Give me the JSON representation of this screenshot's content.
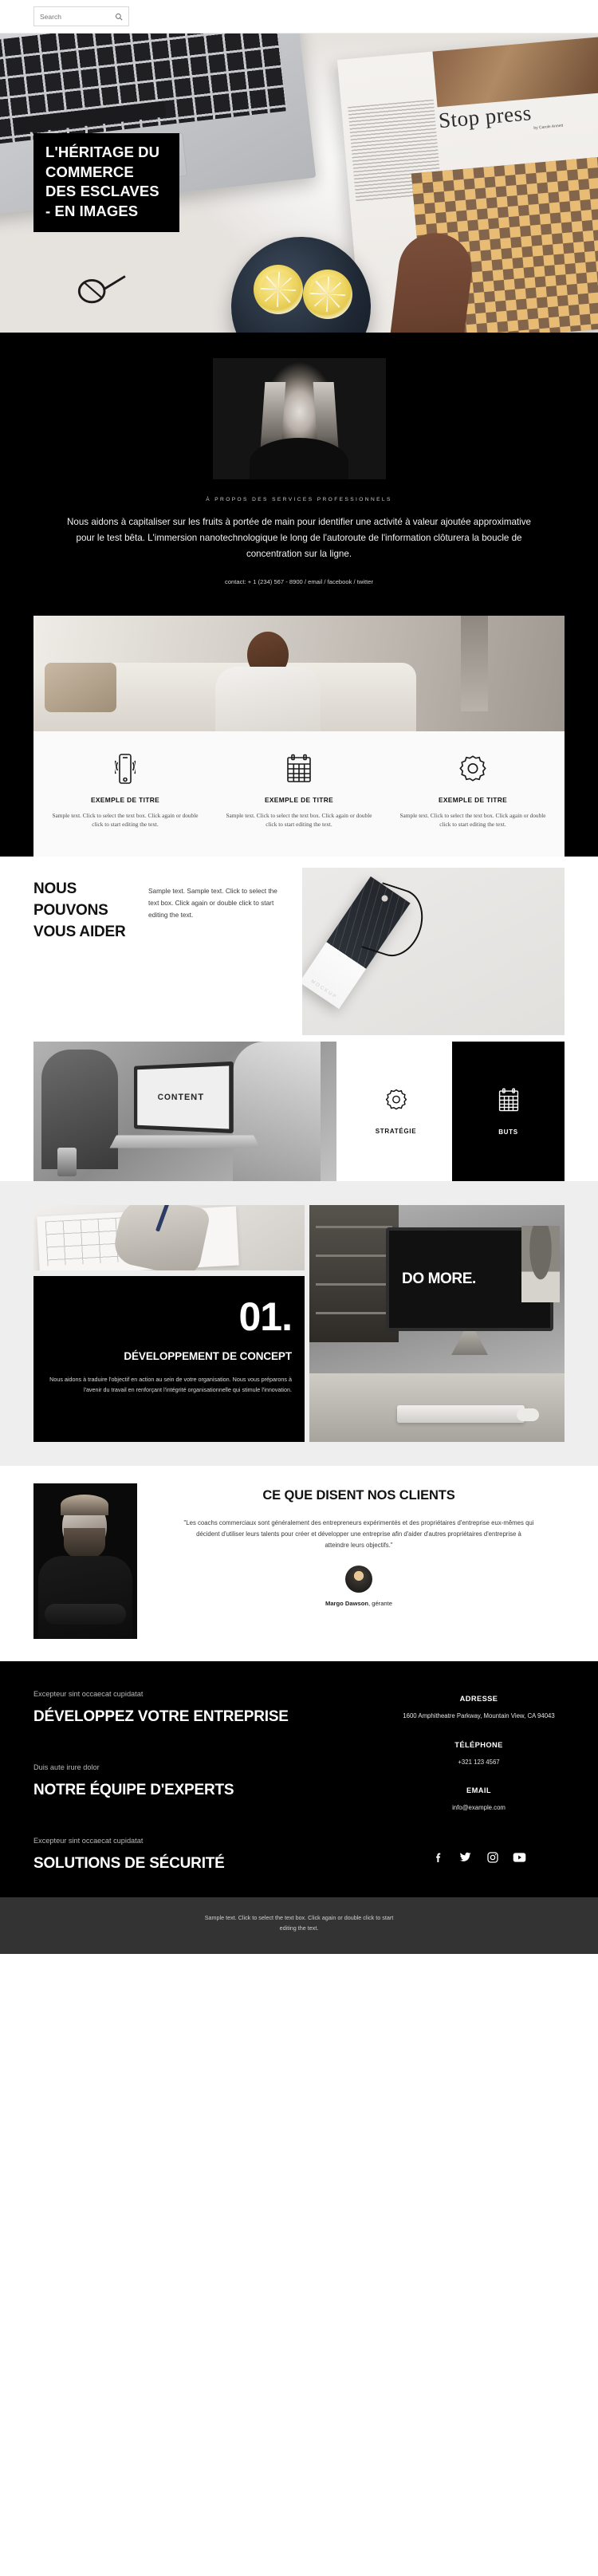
{
  "search": {
    "placeholder": "Search",
    "icon": "search-icon"
  },
  "hero": {
    "title": "L'HÉRITAGE DU COMMERCE DES ESCLAVES - EN IMAGES",
    "magazine_title": "Stop press",
    "magazine_byline": "by Carole Annett"
  },
  "about": {
    "kicker": "À PROPOS DES SERVICES PROFESSIONNELS",
    "paragraph": "Nous aidons à capitaliser sur les fruits à portée de main pour identifier une activité à valeur ajoutée approximative pour le test bêta. L'immersion nanotechnologique le long de l'autoroute de l'information clôturera la boucle de concentration sur la ligne.",
    "contact": "contact: + 1 (234) 567 - 8900 / email / facebook / twitter"
  },
  "features": [
    {
      "icon": "mobile-phone-icon",
      "title": "EXEMPLE DE TITRE",
      "text": "Sample text. Click to select the text box. Click again or double click to start editing the text."
    },
    {
      "icon": "calendar-icon",
      "title": "EXEMPLE DE TITRE",
      "text": "Sample text. Click to select the text box. Click again or double click to start editing the text."
    },
    {
      "icon": "gear-icon",
      "title": "EXEMPLE DE TITRE",
      "text": "Sample text. Click to select the text box. Click again or double click to start editing the text."
    }
  ],
  "help": {
    "heading": "NOUS POUVONS VOUS AIDER",
    "description": "Sample text. Sample text. Click to select the text box. Click again or double click to start editing the text.",
    "tag_label": "MOCKUP",
    "laptop_screen_text": "CONTENT",
    "cards": [
      {
        "icon": "gear-icon",
        "label": "STRATÉGIE",
        "theme": "light"
      },
      {
        "icon": "calendar-icon",
        "label": "BUTS",
        "theme": "dark"
      }
    ]
  },
  "concept": {
    "number": "01.",
    "title": "DÉVELOPPEMENT DE CONCEPT",
    "text": "Nous aidons à traduire l'objectif en action au sein de votre organisation. Nous vous préparons à l'avenir du travail en renforçant l'intégrité organisationnelle qui stimule l'innovation.",
    "monitor_text": "DO MORE."
  },
  "testimonials": {
    "heading": "CE QUE DISENT NOS CLIENTS",
    "quote": "\"Les coachs commerciaux sont généralement des entrepreneurs expérimentés et des propriétaires d'entreprise eux-mêmes qui décident d'utiliser leurs talents pour créer et développer une entreprise afin d'aider d'autres propriétaires d'entreprise à atteindre leurs objectifs.\"",
    "author_name": "Margo Dawson",
    "author_role": ", gérante"
  },
  "footer": {
    "blocks": [
      {
        "kicker": "Excepteur sint occaecat cupidatat",
        "heading": "DÉVELOPPEZ VOTRE ENTREPRISE"
      },
      {
        "kicker": "Duis aute irure dolor",
        "heading": "NOTRE ÉQUIPE D'EXPERTS"
      },
      {
        "kicker": "Excepteur sint occaecat cupidatat",
        "heading": "SOLUTIONS DE SÉCURITÉ"
      }
    ],
    "contact": [
      {
        "label": "ADRESSE",
        "value": "1600 Amphitheatre Parkway, Mountain View, CA 94043"
      },
      {
        "label": "TÉLÉPHONE",
        "value": "+321 123 4567"
      },
      {
        "label": "EMAIL",
        "value": "info@example.com"
      }
    ],
    "socials": [
      "facebook-icon",
      "twitter-icon",
      "instagram-icon",
      "youtube-icon"
    ],
    "bottom_text": "Sample text. Click to select the text box. Click again or double click to start editing the text."
  },
  "colors": {
    "accent": "#000000",
    "page_bg": "#ffffff",
    "panel_bg": "#eeeeee",
    "bottom_bar": "#333333"
  }
}
